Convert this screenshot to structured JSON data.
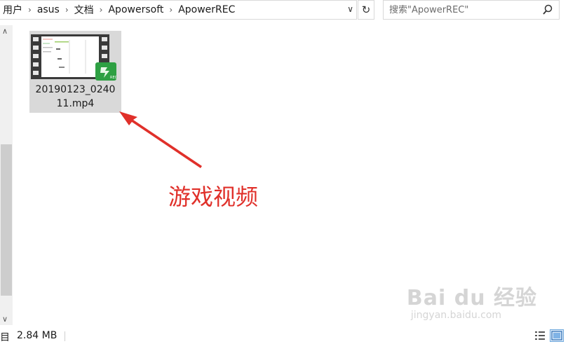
{
  "address_bar": {
    "crumbs": [
      "用户",
      "asus",
      "文档",
      "Apowersoft",
      "ApowerREC"
    ]
  },
  "search": {
    "placeholder": "搜索\"ApowerREC\""
  },
  "file": {
    "name": "20190123_024011.mp4",
    "name_line1": "20190123_0240",
    "name_line2": "11.mp4"
  },
  "annotation": {
    "text": "游戏视频",
    "color": "#e0302a"
  },
  "status_bar": {
    "count_fragment": "目",
    "size": "2.84 MB"
  },
  "watermark": {
    "logo": "Bai du 经验",
    "url": "jingyan.baidu.com"
  },
  "colors": {
    "selection": "#d9d9d9",
    "rec_badge": "#2ea043"
  }
}
